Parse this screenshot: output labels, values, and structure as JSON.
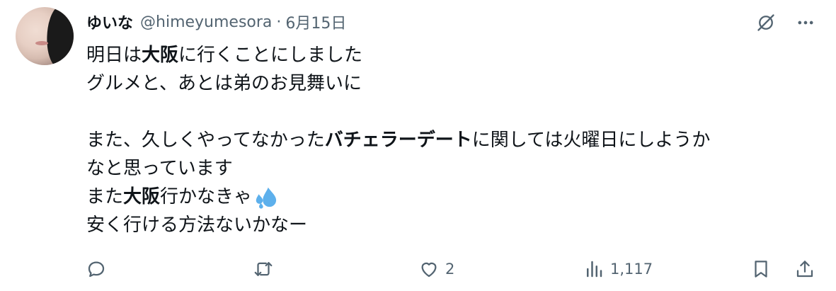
{
  "tweet": {
    "author_name": "ゆいな",
    "handle": "@himeyumesora",
    "separator": "·",
    "date": "6月15日",
    "lines": [
      [
        {
          "text": "明日は",
          "bold": false
        },
        {
          "text": "大阪",
          "bold": true
        },
        {
          "text": "に行くことにしました",
          "bold": false
        }
      ],
      [
        {
          "text": "グルメと、あとは弟のお見舞いに",
          "bold": false
        }
      ],
      [],
      [
        {
          "text": "また、久しくやってなかった",
          "bold": false
        },
        {
          "text": "バチェラーデート",
          "bold": true
        },
        {
          "text": "に関しては火曜日にしようか",
          "bold": false
        }
      ],
      [
        {
          "text": "なと思っています",
          "bold": false
        }
      ],
      [
        {
          "text": "また",
          "bold": false
        },
        {
          "text": "大阪",
          "bold": true
        },
        {
          "text": "行かなきゃ",
          "bold": false
        },
        {
          "emoji": "sweat-droplets-icon"
        }
      ],
      [
        {
          "text": "安く行ける方法ないかなー",
          "bold": false
        }
      ]
    ]
  },
  "actions": {
    "reply_count": "",
    "retweet_count": "",
    "like_count": "2",
    "views_count": "1,117"
  },
  "colors": {
    "text": "#0f1419",
    "secondary": "#536471",
    "emoji_blue": "#5db0ec"
  }
}
